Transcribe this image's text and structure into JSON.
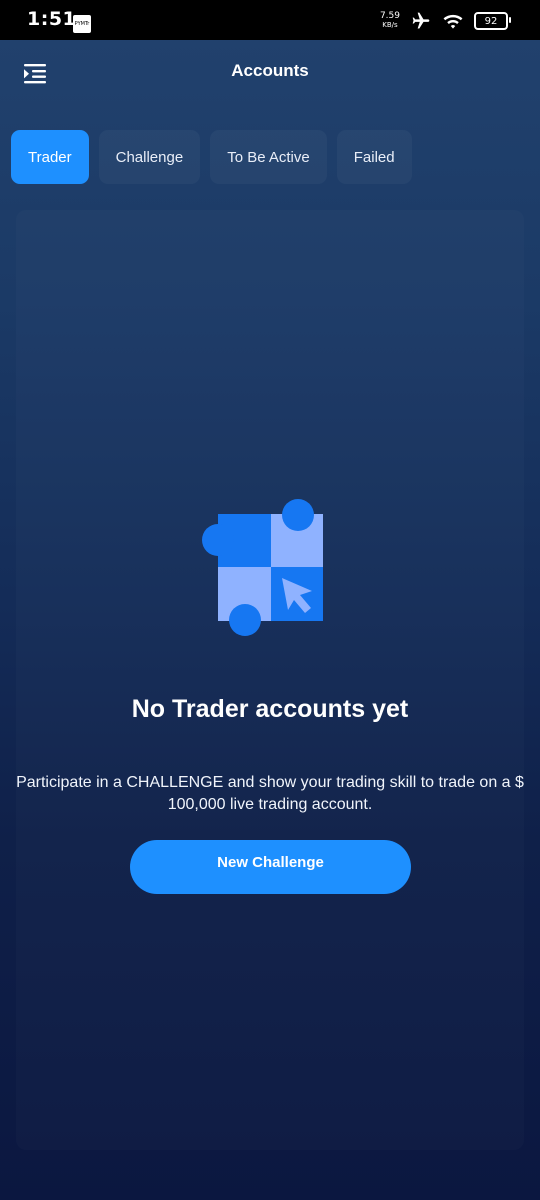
{
  "status_bar": {
    "time": "1:51",
    "net_speed_value": "7.59",
    "net_speed_unit": "KB/s",
    "battery_level": "92",
    "app_icon_text": "PYMTr"
  },
  "header": {
    "title": "Accounts",
    "menu_icon": "menu-indent-icon"
  },
  "tabs": [
    {
      "label": "Trader",
      "active": true
    },
    {
      "label": "Challenge",
      "active": false
    },
    {
      "label": "To Be Active",
      "active": false
    },
    {
      "label": "Failed",
      "active": false
    }
  ],
  "empty_state": {
    "illustration_icon": "puzzle-cursor-icon",
    "title": "No Trader accounts yet",
    "description": "Participate in a CHALLENGE and show your trading skill to trade on a $ 100,000 live trading account.",
    "button_label": "New Challenge"
  },
  "colors": {
    "accent": "#1e90ff",
    "background_top": "#22426e",
    "background_bottom": "#0b1740",
    "illustration_dark": "#1677f2",
    "illustration_light": "#8fb2ff"
  }
}
